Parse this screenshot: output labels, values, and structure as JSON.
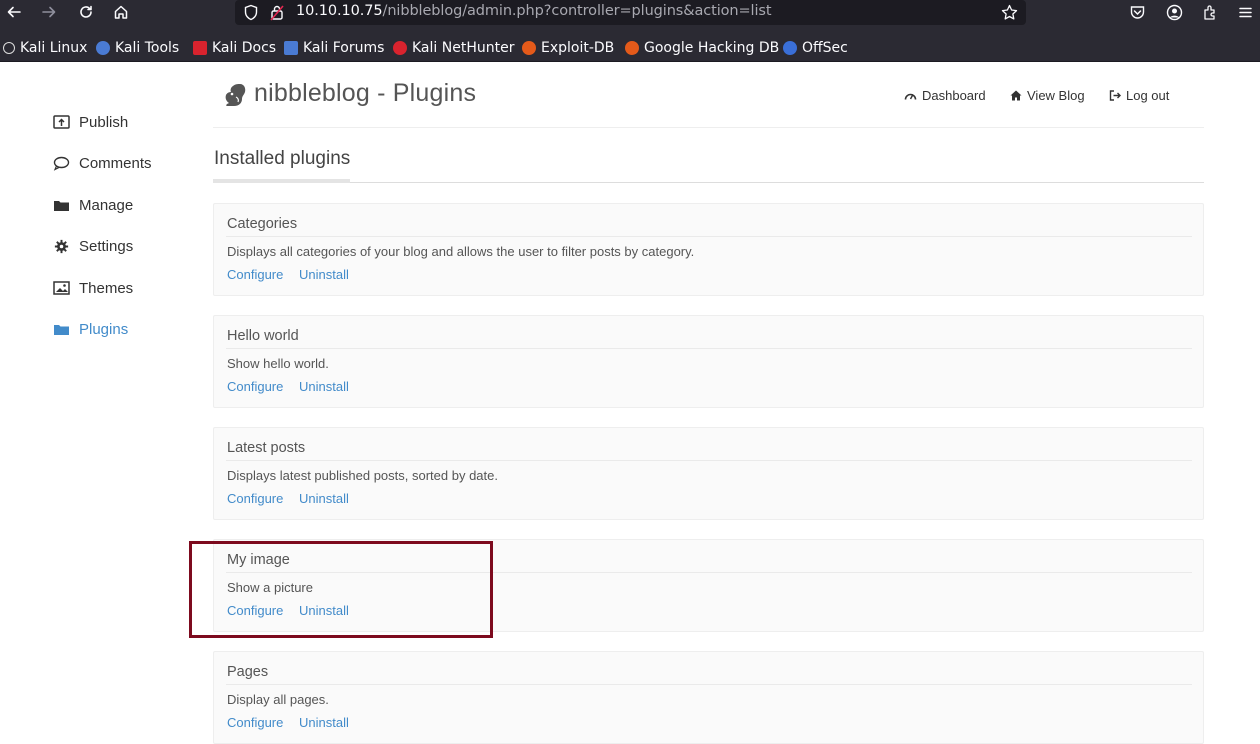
{
  "browser": {
    "url_host": "10.10.10.75",
    "url_path": "/nibbleblog/admin.php?controller=plugins&action=list",
    "bookmarks": [
      {
        "label": "Kali Linux",
        "color": "#ffffff"
      },
      {
        "label": "Kali Tools",
        "color": "#4a7bd4"
      },
      {
        "label": "Kali Docs",
        "color": "#d9232e"
      },
      {
        "label": "Kali Forums",
        "color": "#4a7bd4"
      },
      {
        "label": "Kali NetHunter",
        "color": "#d9232e"
      },
      {
        "label": "Exploit-DB",
        "color": "#e45a1a"
      },
      {
        "label": "Google Hacking DB",
        "color": "#e45a1a"
      },
      {
        "label": "OffSec",
        "color": "#3a6fd8"
      }
    ]
  },
  "sidebar": {
    "items": [
      {
        "label": "Publish",
        "icon": "publish-icon",
        "active": false
      },
      {
        "label": "Comments",
        "icon": "comment-icon",
        "active": false
      },
      {
        "label": "Manage",
        "icon": "folder-icon",
        "active": false
      },
      {
        "label": "Settings",
        "icon": "gear-icon",
        "active": false
      },
      {
        "label": "Themes",
        "icon": "image-icon",
        "active": false
      },
      {
        "label": "Plugins",
        "icon": "folder-icon",
        "active": true
      }
    ]
  },
  "header": {
    "title": "nibbleblog - Plugins",
    "nav": [
      {
        "label": "Dashboard",
        "icon": "dashboard-icon"
      },
      {
        "label": "View Blog",
        "icon": "home-icon"
      },
      {
        "label": "Log out",
        "icon": "logout-icon"
      }
    ]
  },
  "main": {
    "section_title": "Installed plugins",
    "plugins": [
      {
        "name": "Categories",
        "description": "Displays all categories of your blog and allows the user to filter posts by category.",
        "configure": "Configure",
        "uninstall": "Uninstall"
      },
      {
        "name": "Hello world",
        "description": "Show hello world.",
        "configure": "Configure",
        "uninstall": "Uninstall"
      },
      {
        "name": "Latest posts",
        "description": "Displays latest published posts, sorted by date.",
        "configure": "Configure",
        "uninstall": "Uninstall"
      },
      {
        "name": "My image",
        "description": "Show a picture",
        "configure": "Configure",
        "uninstall": "Uninstall"
      },
      {
        "name": "Pages",
        "description": "Display all pages.",
        "configure": "Configure",
        "uninstall": "Uninstall"
      }
    ]
  },
  "colors": {
    "link": "#428bca",
    "highlight": "#7d0a1e",
    "chrome": "#2b2a33"
  }
}
